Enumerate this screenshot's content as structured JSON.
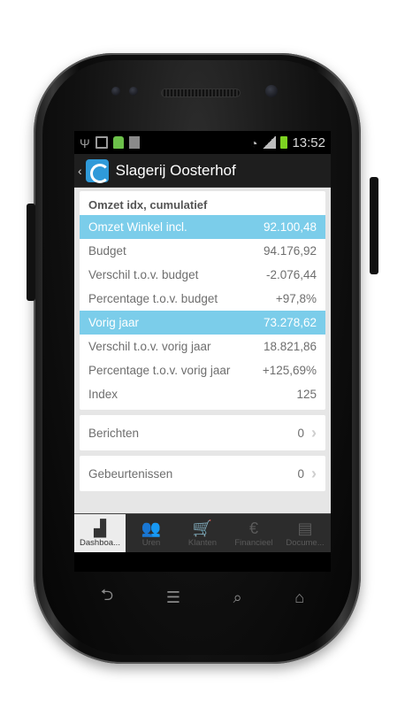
{
  "statusbar": {
    "icons": [
      "usb-icon",
      "image-icon",
      "android-icon",
      "sim-icon",
      "wifi-icon",
      "signal-icon",
      "battery-icon"
    ],
    "time": "13:52"
  },
  "actionbar": {
    "back": "‹",
    "title": "Slagerij Oosterhof"
  },
  "summary": {
    "title": "Omzet idx, cumulatief",
    "rows": [
      {
        "label": "Omzet Winkel incl.",
        "value": "92.100,48"
      },
      {
        "label": "Budget",
        "value": "94.176,92"
      },
      {
        "label": "Verschil t.o.v. budget",
        "value": "-2.076,44"
      },
      {
        "label": "Percentage t.o.v. budget",
        "value": "+97,8%"
      },
      {
        "label": "Vorig jaar",
        "value": "73.278,62"
      },
      {
        "label": "Verschil t.o.v. vorig jaar",
        "value": "18.821,86"
      },
      {
        "label": "Percentage t.o.v. vorig jaar",
        "value": "+125,69%"
      },
      {
        "label": "Index",
        "value": "125"
      }
    ]
  },
  "links": [
    {
      "label": "Berichten",
      "count": "0"
    },
    {
      "label": "Gebeurtenissen",
      "count": "0"
    }
  ],
  "tabs": [
    {
      "label": "Dashboa...",
      "icon": "bar-chart-icon"
    },
    {
      "label": "Uren",
      "icon": "people-icon"
    },
    {
      "label": "Klanten",
      "icon": "cart-icon"
    },
    {
      "label": "Financieel",
      "icon": "euro-icon"
    },
    {
      "label": "Docume...",
      "icon": "document-icon"
    }
  ],
  "colors": {
    "highlight": "#7bcdea",
    "accent": "#2f9ad9"
  }
}
